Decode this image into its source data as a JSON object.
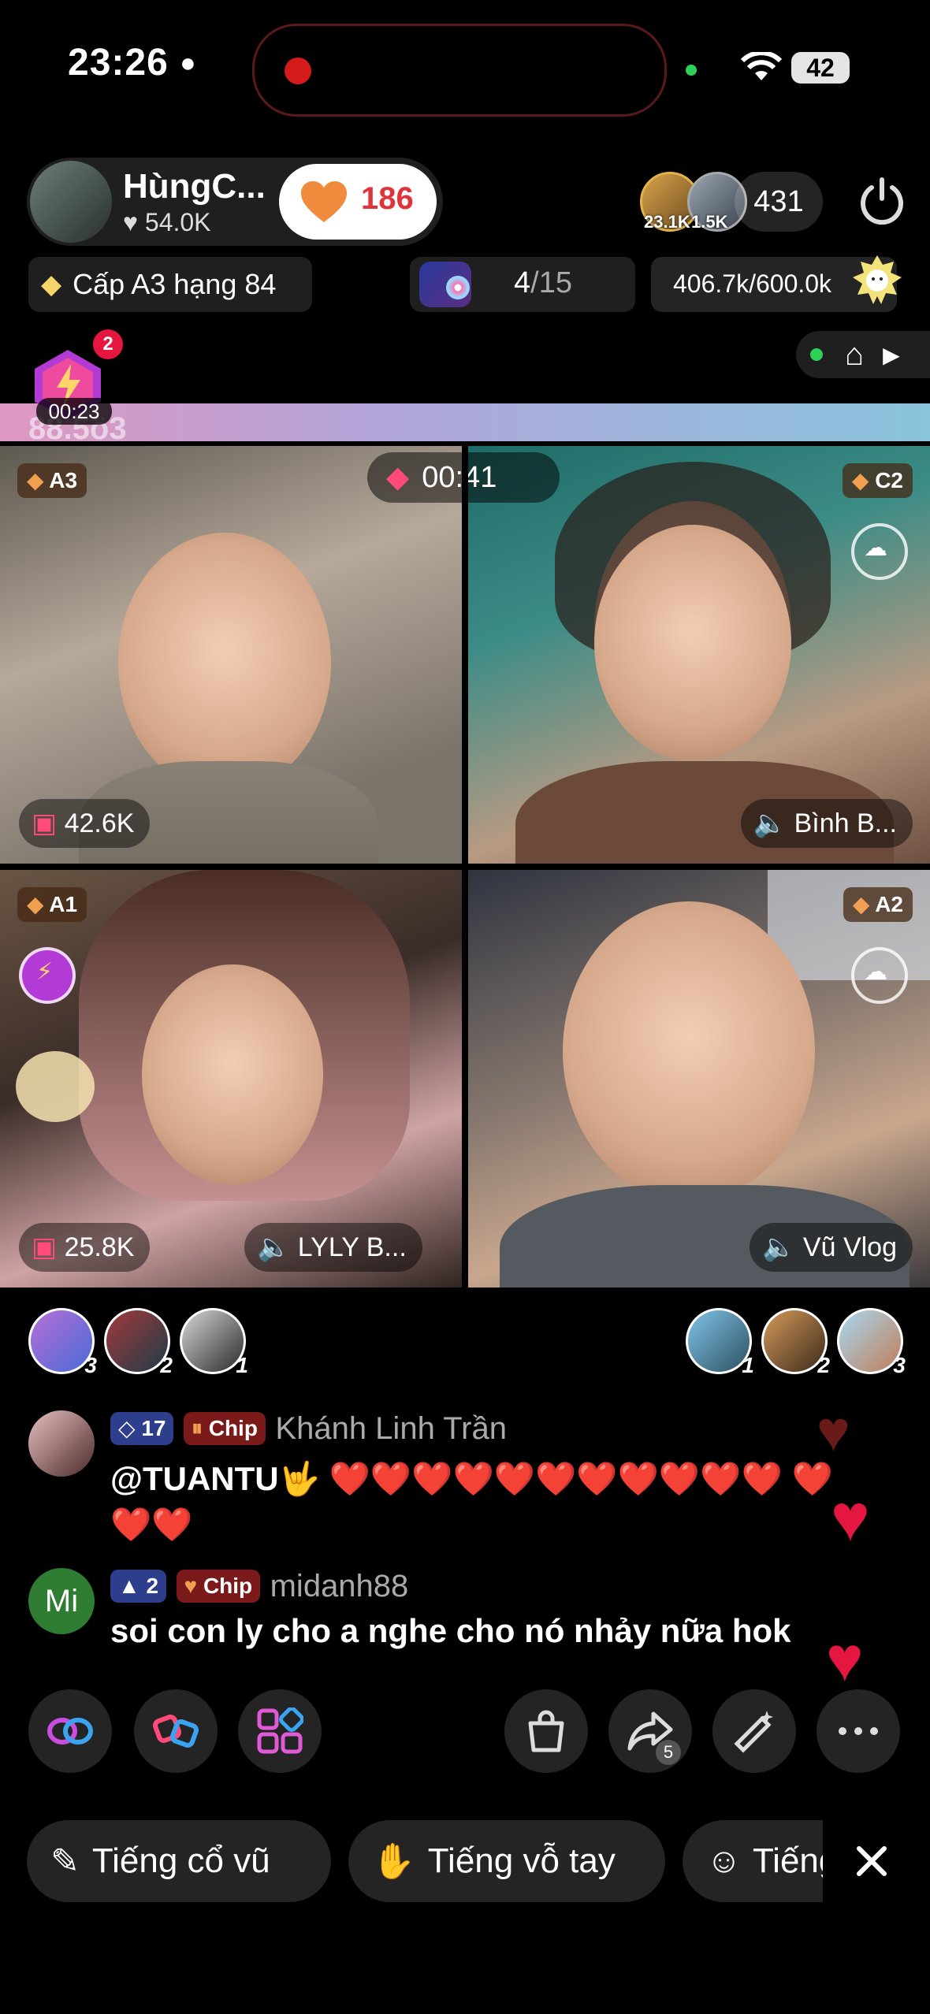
{
  "status_bar": {
    "time": "23:26",
    "battery": "42"
  },
  "host": {
    "name": "HùngC...",
    "likes": "54.0K",
    "like_count": "186"
  },
  "viewers": {
    "avatar1_badge": "23.1K",
    "avatar2_badge": "1.5K",
    "count": "431"
  },
  "rank": {
    "label": "Cấp A3 hạng 84"
  },
  "progress": {
    "current": "4",
    "total": "/15"
  },
  "target": {
    "text": "406.7k/600.0k"
  },
  "battle": {
    "badge": "2",
    "timer": "00:23",
    "score": "88.5ö3",
    "round_timer": "00:41"
  },
  "cells": [
    {
      "tag": "A3",
      "count": "42.6K"
    },
    {
      "tag": "C2",
      "name": "Bình B..."
    },
    {
      "tag": "A1",
      "count": "25.8K",
      "name": "LYLY B..."
    },
    {
      "tag": "A2",
      "name": "Vũ Vlog"
    }
  ],
  "supporters_left": [
    "3",
    "2",
    "1"
  ],
  "supporters_right": [
    "1",
    "2",
    "3"
  ],
  "chat": [
    {
      "level": "17",
      "chip": "Chip",
      "name": "Khánh Linh Trần",
      "message": "@TUANTU🤟 ❤️❤️❤️❤️❤️❤️❤️❤️❤️❤️❤️ ❤️❤️❤️"
    },
    {
      "avatar_text": "Mi",
      "level": "2",
      "chip": "Chip",
      "name": "midanh88",
      "message": "soi con ly cho a nghe cho nó nhảy nữa hok"
    }
  ],
  "toolbar": {
    "share_count": "5"
  },
  "phrases": [
    "Tiếng cổ vũ",
    "Tiếng vỗ tay",
    "Tiếng"
  ],
  "colors": {
    "like_heart": "#f08a3c",
    "heart_red": "#e5163f",
    "tag_brown": "#5a3418"
  }
}
